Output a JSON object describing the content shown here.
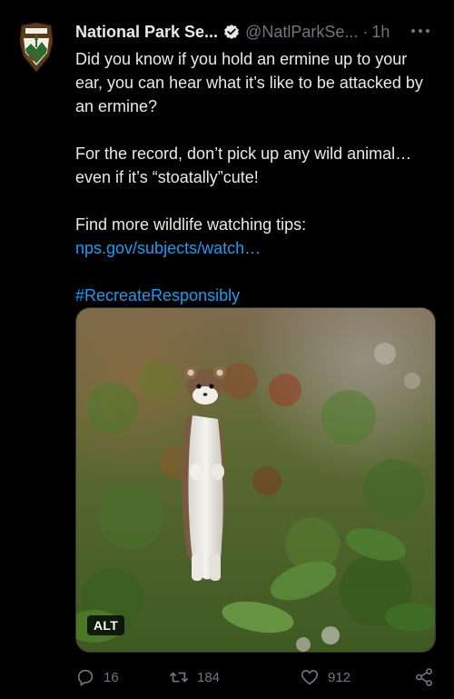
{
  "author": {
    "display_name": "National Park Se...",
    "handle": "@NatlParkSe...",
    "separator": "·",
    "time": "1h",
    "avatar_icon": "nps-arrowhead-logo",
    "verified_icon": "verified-badge-icon"
  },
  "tweet": {
    "paragraph1": "Did you know if you hold an ermine up to your ear, you can hear what it’s like to be attacked by an ermine?",
    "paragraph2": "For the record, don’t pick up any wild animal… even if it’s “stoatally”cute!",
    "paragraph3": "Find more wildlife watching tips:",
    "link": "nps.gov/subjects/watch…",
    "hashtag": "#RecreateResponsibly"
  },
  "media": {
    "alt_label": "ALT"
  },
  "actions": {
    "replies": "16",
    "retweets": "184",
    "likes": "912"
  },
  "colors": {
    "background": "#000000",
    "text": "#e7e9ea",
    "muted": "#71767b",
    "link": "#1d9bf0"
  }
}
